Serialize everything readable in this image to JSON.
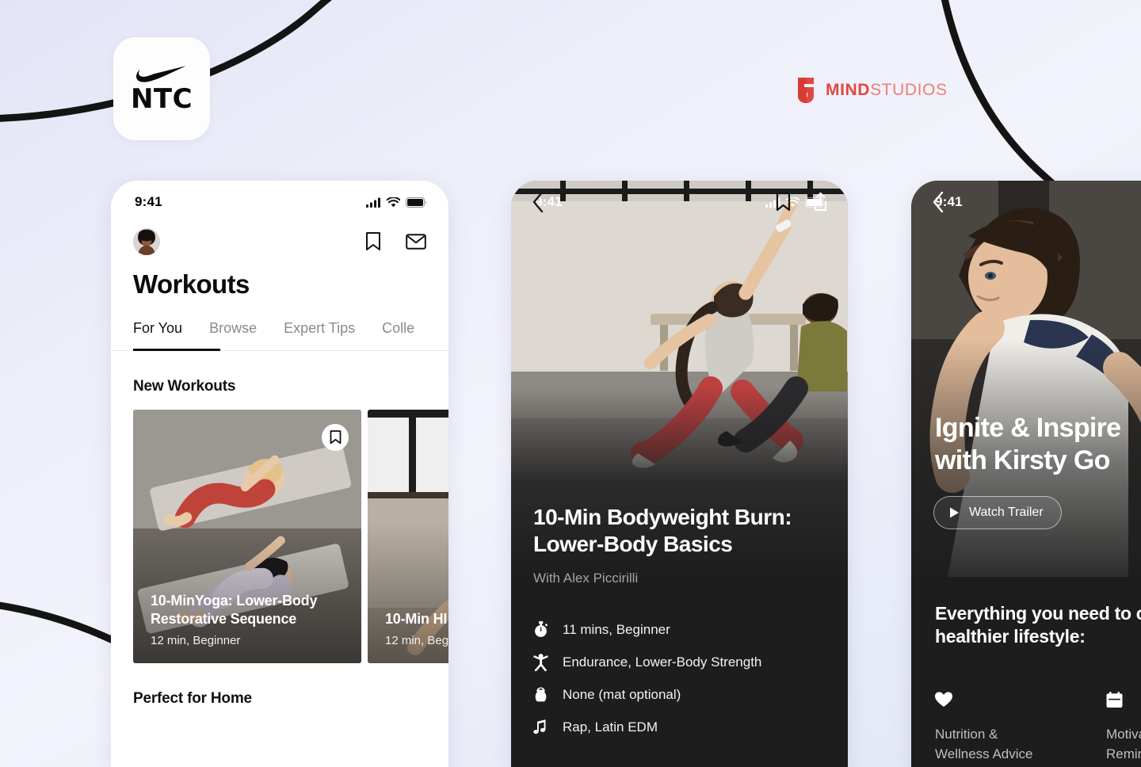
{
  "brand": {
    "app_icon": {
      "name": "Nike NTC",
      "label": "NTC",
      "icon": "nike-swoosh-icon"
    },
    "studio_logo": {
      "mark": "mindstudios-mark-icon",
      "bold_part": "MIND",
      "light_part": "STUDIOS",
      "color": "#e0483f"
    }
  },
  "background": {
    "gradient_from": "#e3e5f7",
    "gradient_to": "#e2e6f6",
    "curve_color": "#111111"
  },
  "phone1": {
    "status": {
      "time": "9:41",
      "cellular": "signal-icon",
      "wifi": "wifi-icon",
      "battery": "battery-icon"
    },
    "avatar": "user-avatar",
    "actions": [
      {
        "name": "bookmark-icon",
        "label": "Saved"
      },
      {
        "name": "envelope-icon",
        "label": "Inbox"
      }
    ],
    "title": "Workouts",
    "tabs": [
      {
        "label": "For You",
        "active": true
      },
      {
        "label": "Browse",
        "active": false
      },
      {
        "label": "Expert Tips",
        "active": false
      },
      {
        "label": "Colle",
        "active": false
      }
    ],
    "sections": [
      {
        "heading": "New Workouts"
      },
      {
        "heading": "Perfect for Home"
      }
    ],
    "cards": [
      {
        "title": "10-MinYoga: Lower-Body Restorative Sequence",
        "meta": "12 min, Beginner",
        "bookmark": "bookmark-icon"
      },
      {
        "title": "10-Min HI",
        "meta": "12 min, Beg"
      }
    ]
  },
  "phone2": {
    "status": {
      "time": "9:41",
      "cellular": "signal-icon",
      "wifi": "wifi-icon",
      "battery": "battery-icon"
    },
    "nav": {
      "back": "chevron-left-icon",
      "bookmark": "bookmark-icon",
      "share": "share-icon"
    },
    "title": "10-Min Bodyweight Burn: Lower-Body Basics",
    "subtitle": "With Alex Piccirilli",
    "details": [
      {
        "icon": "stopwatch-icon",
        "text": "11 mins, Beginner"
      },
      {
        "icon": "runner-icon",
        "text": "Endurance, Lower-Body Strength"
      },
      {
        "icon": "kettlebell-icon",
        "text": "None (mat optional)"
      },
      {
        "icon": "music-note-icon",
        "text": "Rap, Latin EDM"
      }
    ]
  },
  "phone3": {
    "status": {
      "time": "9:41"
    },
    "nav": {
      "back": "chevron-left-icon"
    },
    "title_line1": "Ignite & Inspire",
    "title_line2": "with Kirsty Go",
    "trailer_button": {
      "label": "Watch Trailer",
      "icon": "play-icon"
    },
    "heading_line1": "Everything you need to c",
    "heading_line2": "healthier lifestyle:",
    "features": [
      {
        "icon": "heart-icon",
        "line1": "Nutrition &",
        "line2": "Wellness Advice"
      },
      {
        "icon": "calendar-icon",
        "line1": "Motiva",
        "line2": "Remin"
      }
    ]
  }
}
